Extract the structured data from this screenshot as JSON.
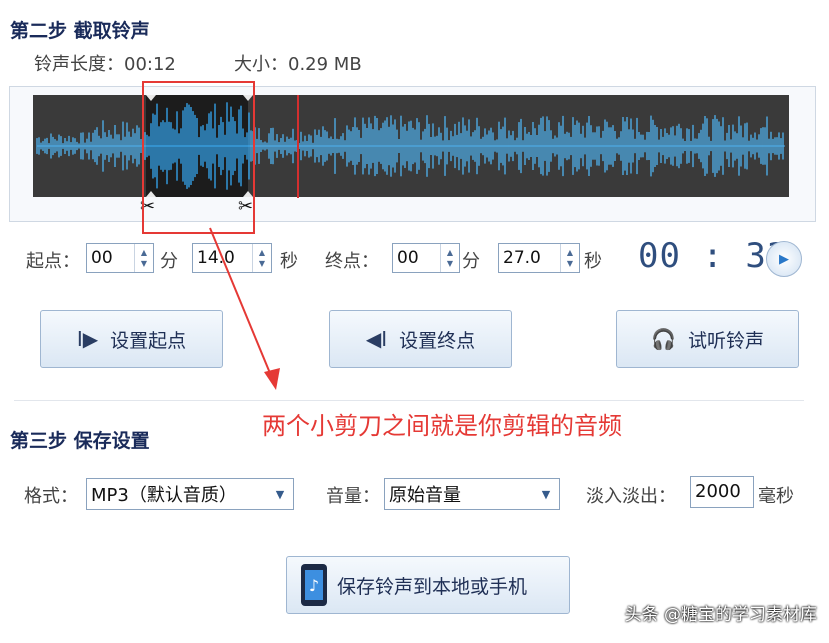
{
  "step2": {
    "title": "第二步  截取铃声",
    "length_label": "铃声长度：",
    "length_value": "00:12",
    "size_label": "大小：",
    "size_value": "0.29 MB"
  },
  "waveform": {
    "colors": {
      "wave": "#4fb3f0",
      "selected_wave": "#35a9f5",
      "background": "#3a3a3a",
      "selection_bg": "#1c1c1c",
      "playhead": "#d32f2f"
    },
    "cut_marker_icon": "scissors-icon"
  },
  "controls": {
    "start_label": "起点：",
    "start_min": "00",
    "min_unit": "分",
    "start_sec": "14.0",
    "sec_unit": "秒",
    "end_label": "终点：",
    "end_min": "00",
    "end_sec": "27.0",
    "timer": "00 : 33"
  },
  "buttons": {
    "set_start": "设置起点",
    "set_end": "设置终点",
    "preview": "试听铃声"
  },
  "annotation": "两个小剪刀之间就是你剪辑的音频",
  "step3": {
    "title": "第三步  保存设置",
    "format_label": "格式：",
    "format_value": "MP3（默认音质）",
    "volume_label": "音量：",
    "volume_value": "原始音量",
    "fade_label": "淡入淡出：",
    "fade_value": "2000",
    "fade_unit": "毫秒",
    "save_button": "保存铃声到本地或手机"
  },
  "watermark": "头条 @糖宝的学习素材库"
}
